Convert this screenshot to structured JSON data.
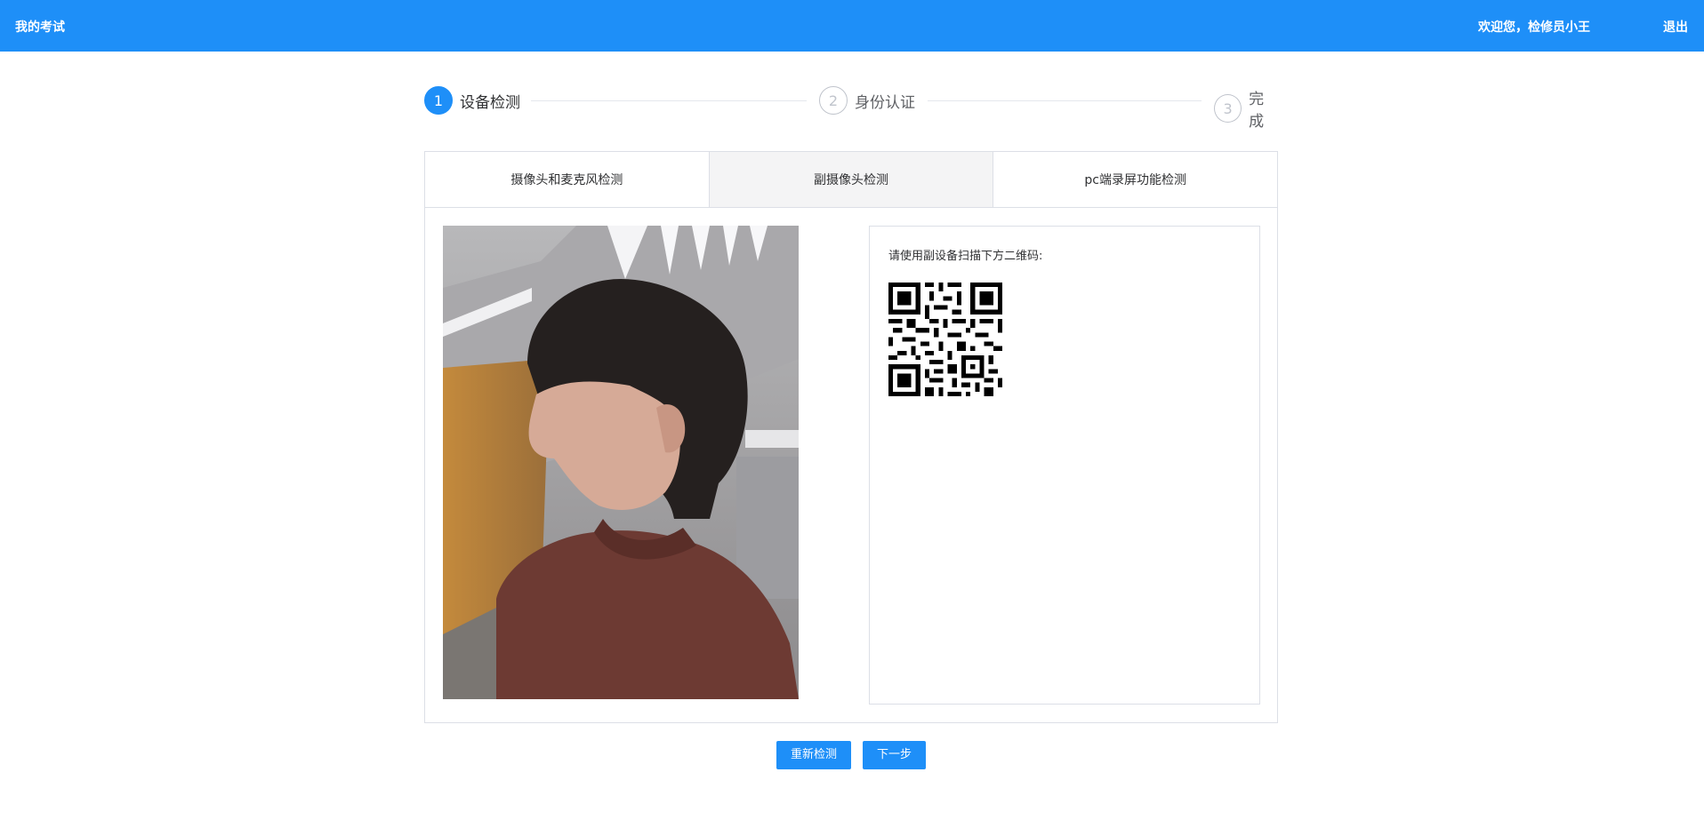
{
  "header": {
    "title": "我的考试",
    "welcome": "欢迎您，检修员小王",
    "logout": "退出"
  },
  "steps": [
    {
      "number": "1",
      "label": "设备检测",
      "active": true
    },
    {
      "number": "2",
      "label": "身份认证",
      "active": false
    },
    {
      "number": "3",
      "label": "完成",
      "active": false
    }
  ],
  "tabs": [
    {
      "label": "摄像头和麦克风检测",
      "active": false
    },
    {
      "label": "副摄像头检测",
      "active": true
    },
    {
      "label": "pc端录屏功能检测",
      "active": false
    }
  ],
  "qr_panel": {
    "hint": "请使用副设备扫描下方二维码:"
  },
  "actions": {
    "retest": "重新检测",
    "next": "下一步"
  },
  "colors": {
    "primary": "#1e8ff8",
    "border": "#dcdfe6",
    "active_tab_bg": "#f4f4f5"
  }
}
